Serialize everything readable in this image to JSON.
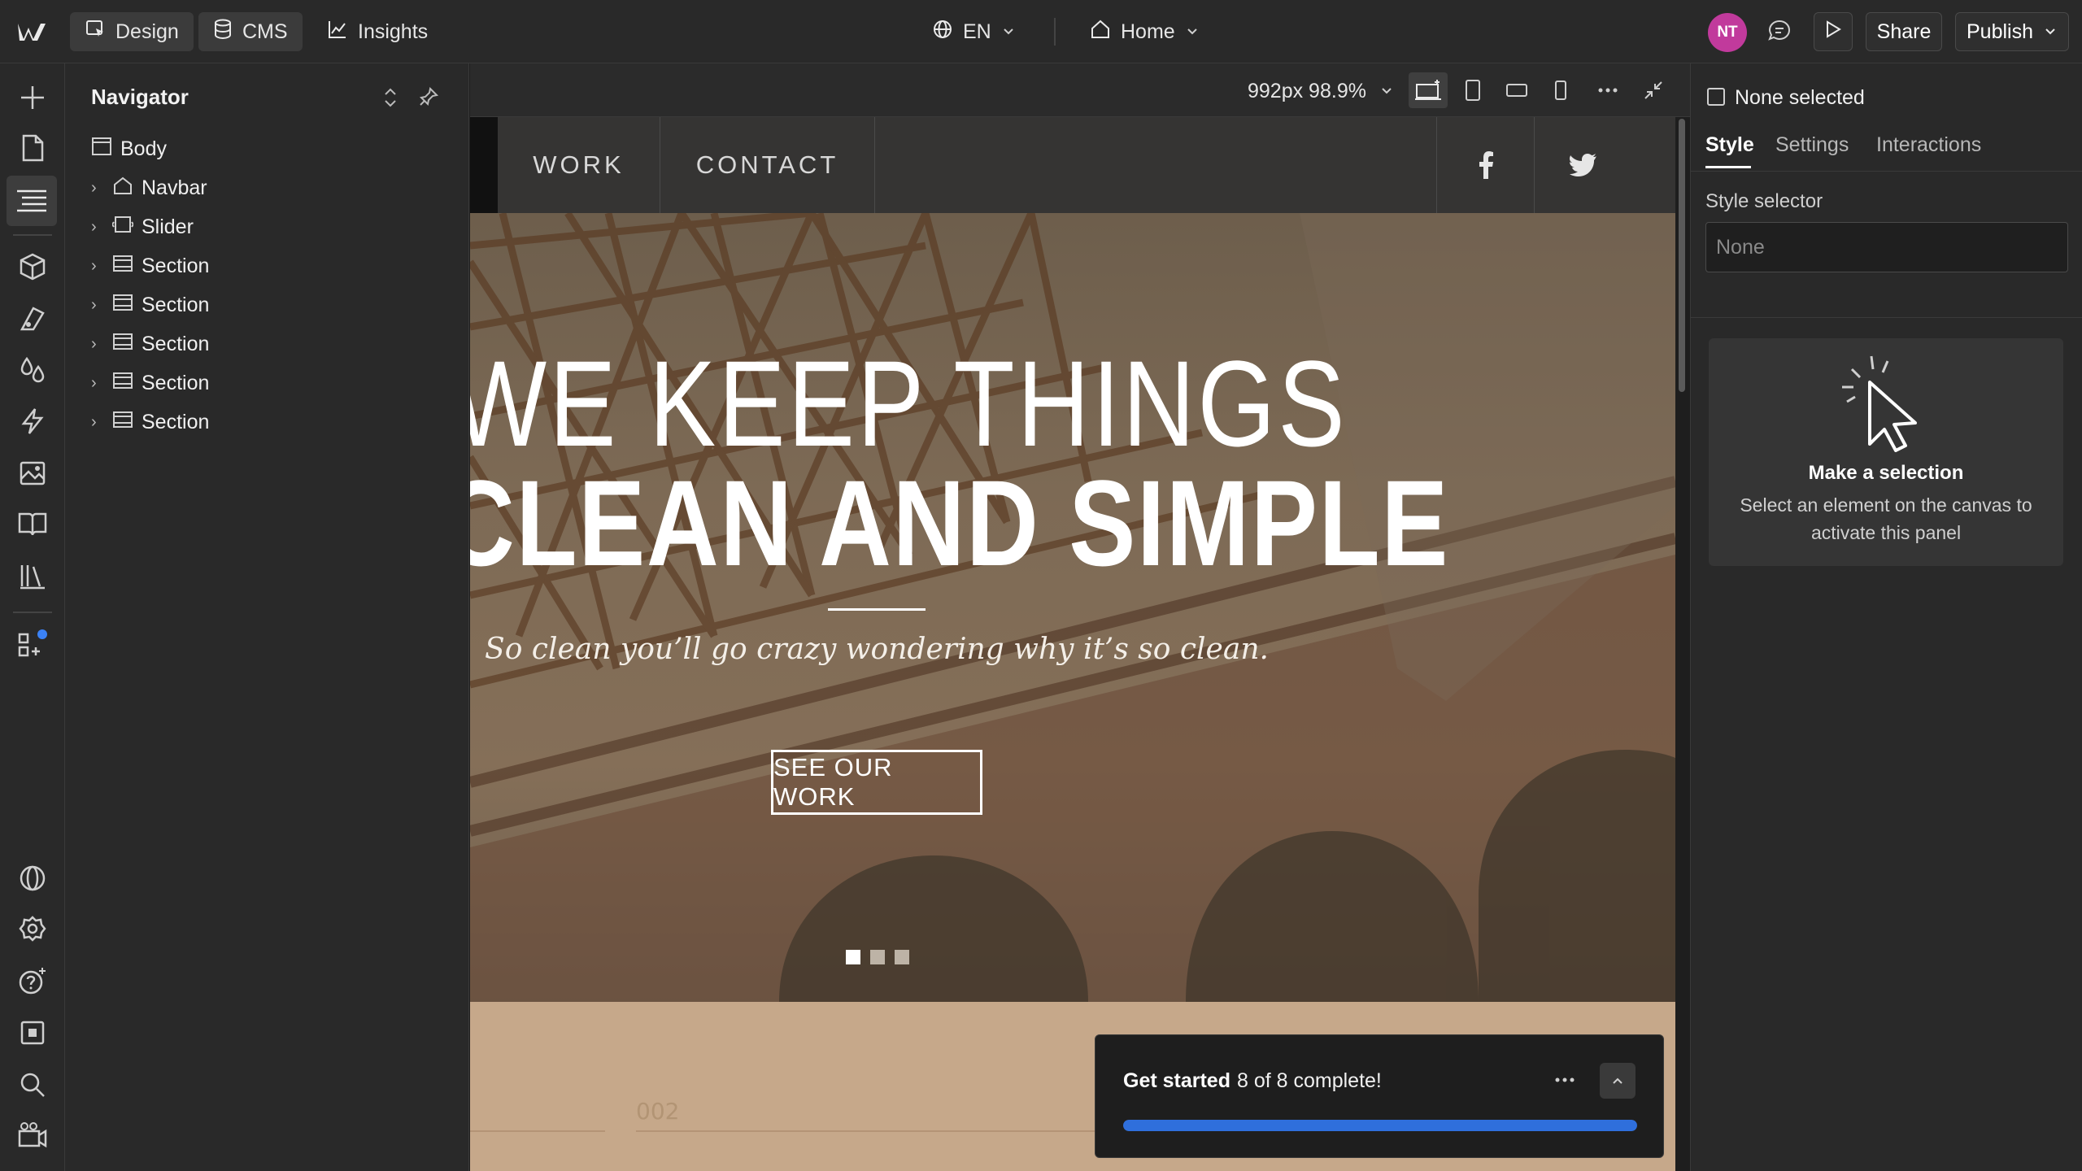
{
  "topbar": {
    "design_label": "Design",
    "cms_label": "CMS",
    "insights_label": "Insights",
    "locale": "EN",
    "page": "Home",
    "avatar_initials": "NT",
    "share_label": "Share",
    "publish_label": "Publish"
  },
  "navigator": {
    "title": "Navigator",
    "items": [
      {
        "label": "Body"
      },
      {
        "label": "Navbar"
      },
      {
        "label": "Slider"
      },
      {
        "label": "Section"
      },
      {
        "label": "Section"
      },
      {
        "label": "Section"
      },
      {
        "label": "Section"
      },
      {
        "label": "Section"
      }
    ]
  },
  "canvas_toolbar": {
    "size": "992px 98.9%"
  },
  "site": {
    "nav": {
      "work": "WORK",
      "contact": "CONTACT"
    },
    "hero": {
      "line1": "WE KEEP THINGS",
      "line2": "CLEAN AND SIMPLE",
      "subtitle": "So clean you’ll go crazy wondering why it’s so clean.",
      "button": "SEE OUR WORK",
      "active_slide": 1,
      "slide_count": 3
    },
    "section2": {
      "number": "002"
    }
  },
  "toast": {
    "title": "Get started",
    "count": "8 of 8 complete!",
    "progress": 1.0
  },
  "right_panel": {
    "none_selected": "None selected",
    "tabs": [
      "Style",
      "Settings",
      "Interactions"
    ],
    "style_selector_label": "Style selector",
    "style_selector_placeholder": "None",
    "card_title": "Make a selection",
    "card_desc": "Select an element on the canvas to activate this panel"
  },
  "colors": {
    "accent": "#2f6fdc",
    "avatar": "#c13a9c",
    "panel_bg": "#292929"
  }
}
